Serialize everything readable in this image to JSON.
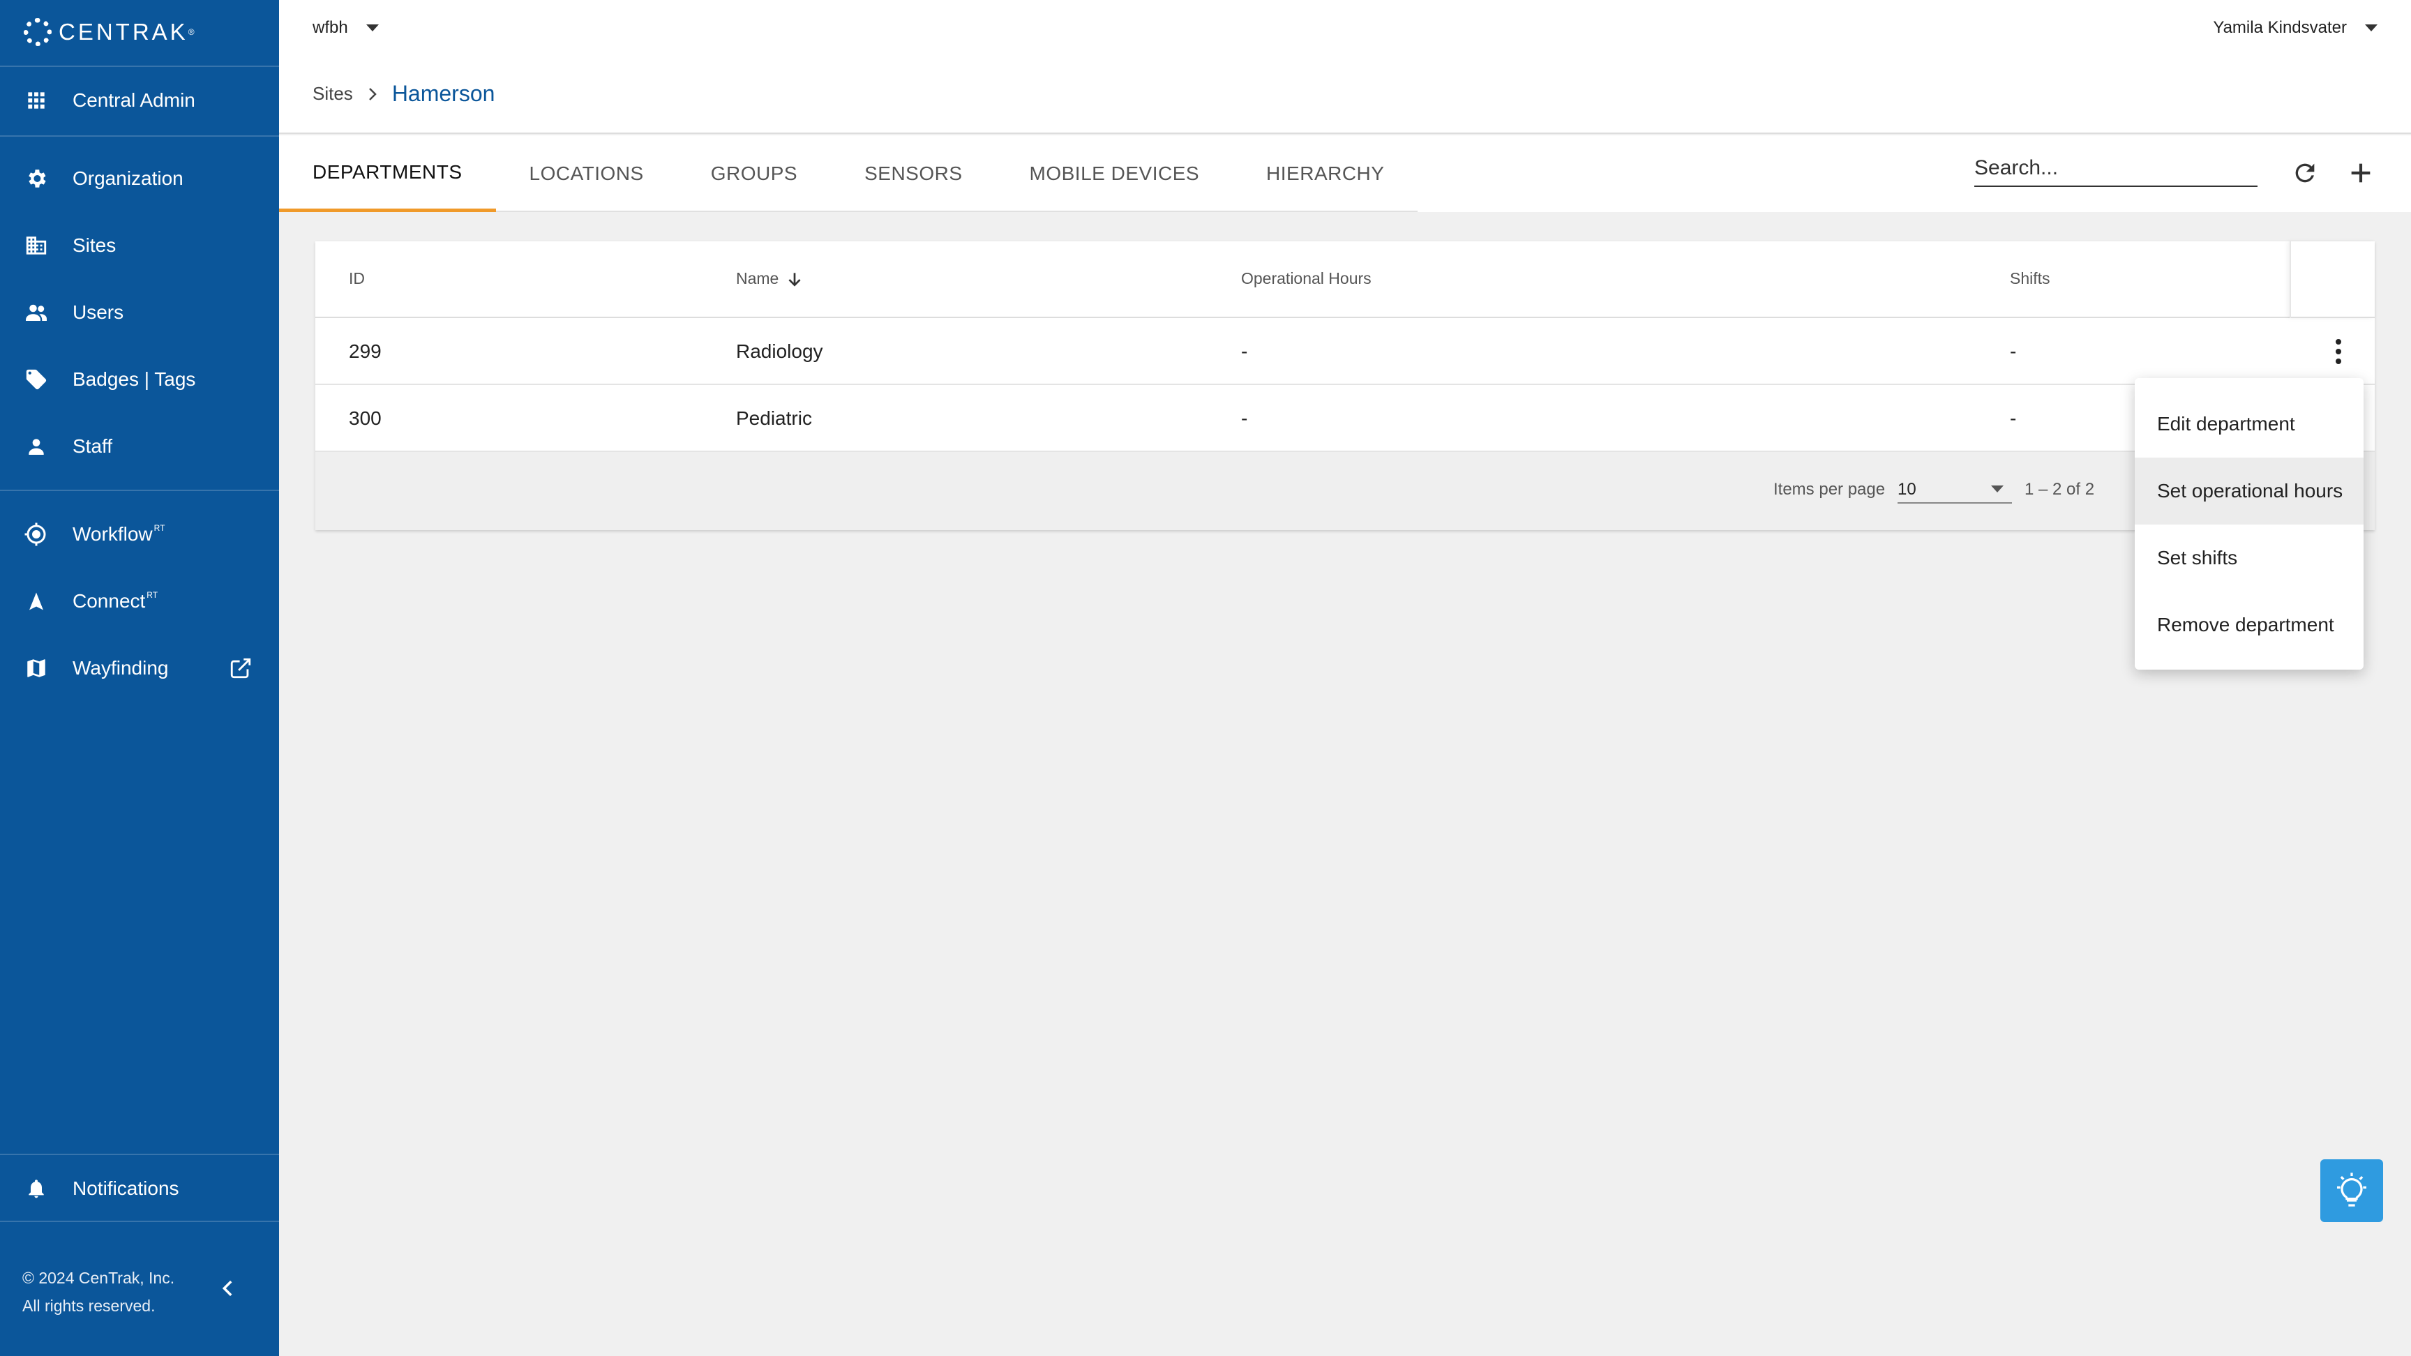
{
  "brand": {
    "name": "CENTRAK",
    "reg": "®"
  },
  "sidebar": {
    "items": [
      {
        "label": "Central Admin",
        "icon": "apps-grid-icon"
      },
      {
        "label": "Organization",
        "icon": "gear-icon"
      },
      {
        "label": "Sites",
        "icon": "building-icon"
      },
      {
        "label": "Users",
        "icon": "users-icon"
      },
      {
        "label": "Badges | Tags",
        "icon": "tag-icon"
      },
      {
        "label": "Staff",
        "icon": "person-icon"
      },
      {
        "label": "Workflow",
        "sup": "RT",
        "icon": "workflow-icon"
      },
      {
        "label": "Connect",
        "sup": "RT",
        "icon": "connect-icon"
      },
      {
        "label": "Wayfinding",
        "icon": "map-icon"
      },
      {
        "label": "Notifications",
        "icon": "bell-icon"
      }
    ],
    "footer_line1": "© 2024 CenTrak, Inc.",
    "footer_line2": "All rights reserved."
  },
  "header": {
    "tenant": "wfbh",
    "user": "Yamila Kindsvater",
    "breadcrumb_root": "Sites",
    "breadcrumb_current": "Hamerson"
  },
  "tabs": [
    {
      "label": "DEPARTMENTS",
      "active": true
    },
    {
      "label": "LOCATIONS"
    },
    {
      "label": "GROUPS"
    },
    {
      "label": "SENSORS"
    },
    {
      "label": "MOBILE DEVICES"
    },
    {
      "label": "HIERARCHY"
    }
  ],
  "search": {
    "placeholder": "Search..."
  },
  "table": {
    "columns": [
      "ID",
      "Name",
      "Operational Hours",
      "Shifts"
    ],
    "rows": [
      {
        "id": "299",
        "name": "Radiology",
        "hours": "-",
        "shifts": "-"
      },
      {
        "id": "300",
        "name": "Pediatric",
        "hours": "-",
        "shifts": "-"
      }
    ],
    "items_per_page_label": "Items per page",
    "items_per_page": "10",
    "range": "1 – 2 of 2"
  },
  "menu": {
    "items": [
      "Edit department",
      "Set operational hours",
      "Set shifts",
      "Remove department"
    ]
  },
  "colors": {
    "sidebar": "#0b569a",
    "accent_tab": "#f09a2a",
    "help_button": "#2f9be0"
  }
}
